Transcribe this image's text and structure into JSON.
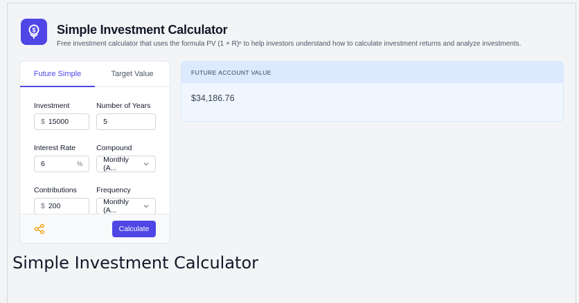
{
  "app": {
    "title": "Simple Investment Calculator",
    "subtitle": "Free investment calculator that uses the formula PV (1 + R)ⁿ to help investors understand how to calculate investment returns and analyze investments.",
    "logo_icon": "dollar-flower-icon",
    "accent_color": "#4f46e5"
  },
  "tabs": [
    {
      "label": "Future Simple",
      "active": true
    },
    {
      "label": "Target Value",
      "active": false
    }
  ],
  "form": {
    "investment": {
      "label": "Investment",
      "prefix": "$",
      "value": "15000"
    },
    "years": {
      "label": "Number of Years",
      "value": "5"
    },
    "interest": {
      "label": "Interest Rate",
      "value": "6",
      "suffix": "%"
    },
    "compound": {
      "label": "Compound",
      "value": "Monthly (A..."
    },
    "contributions": {
      "label": "Contributions",
      "prefix": "$",
      "value": "200"
    },
    "frequency": {
      "label": "Frequency",
      "value": "Monthly (A..."
    }
  },
  "footer": {
    "share_icon": "share-icon",
    "calculate_label": "Calculate"
  },
  "result": {
    "heading": "FUTURE ACCOUNT VALUE",
    "value": "$34,186.76"
  },
  "caption": "Simple Investment Calculator"
}
